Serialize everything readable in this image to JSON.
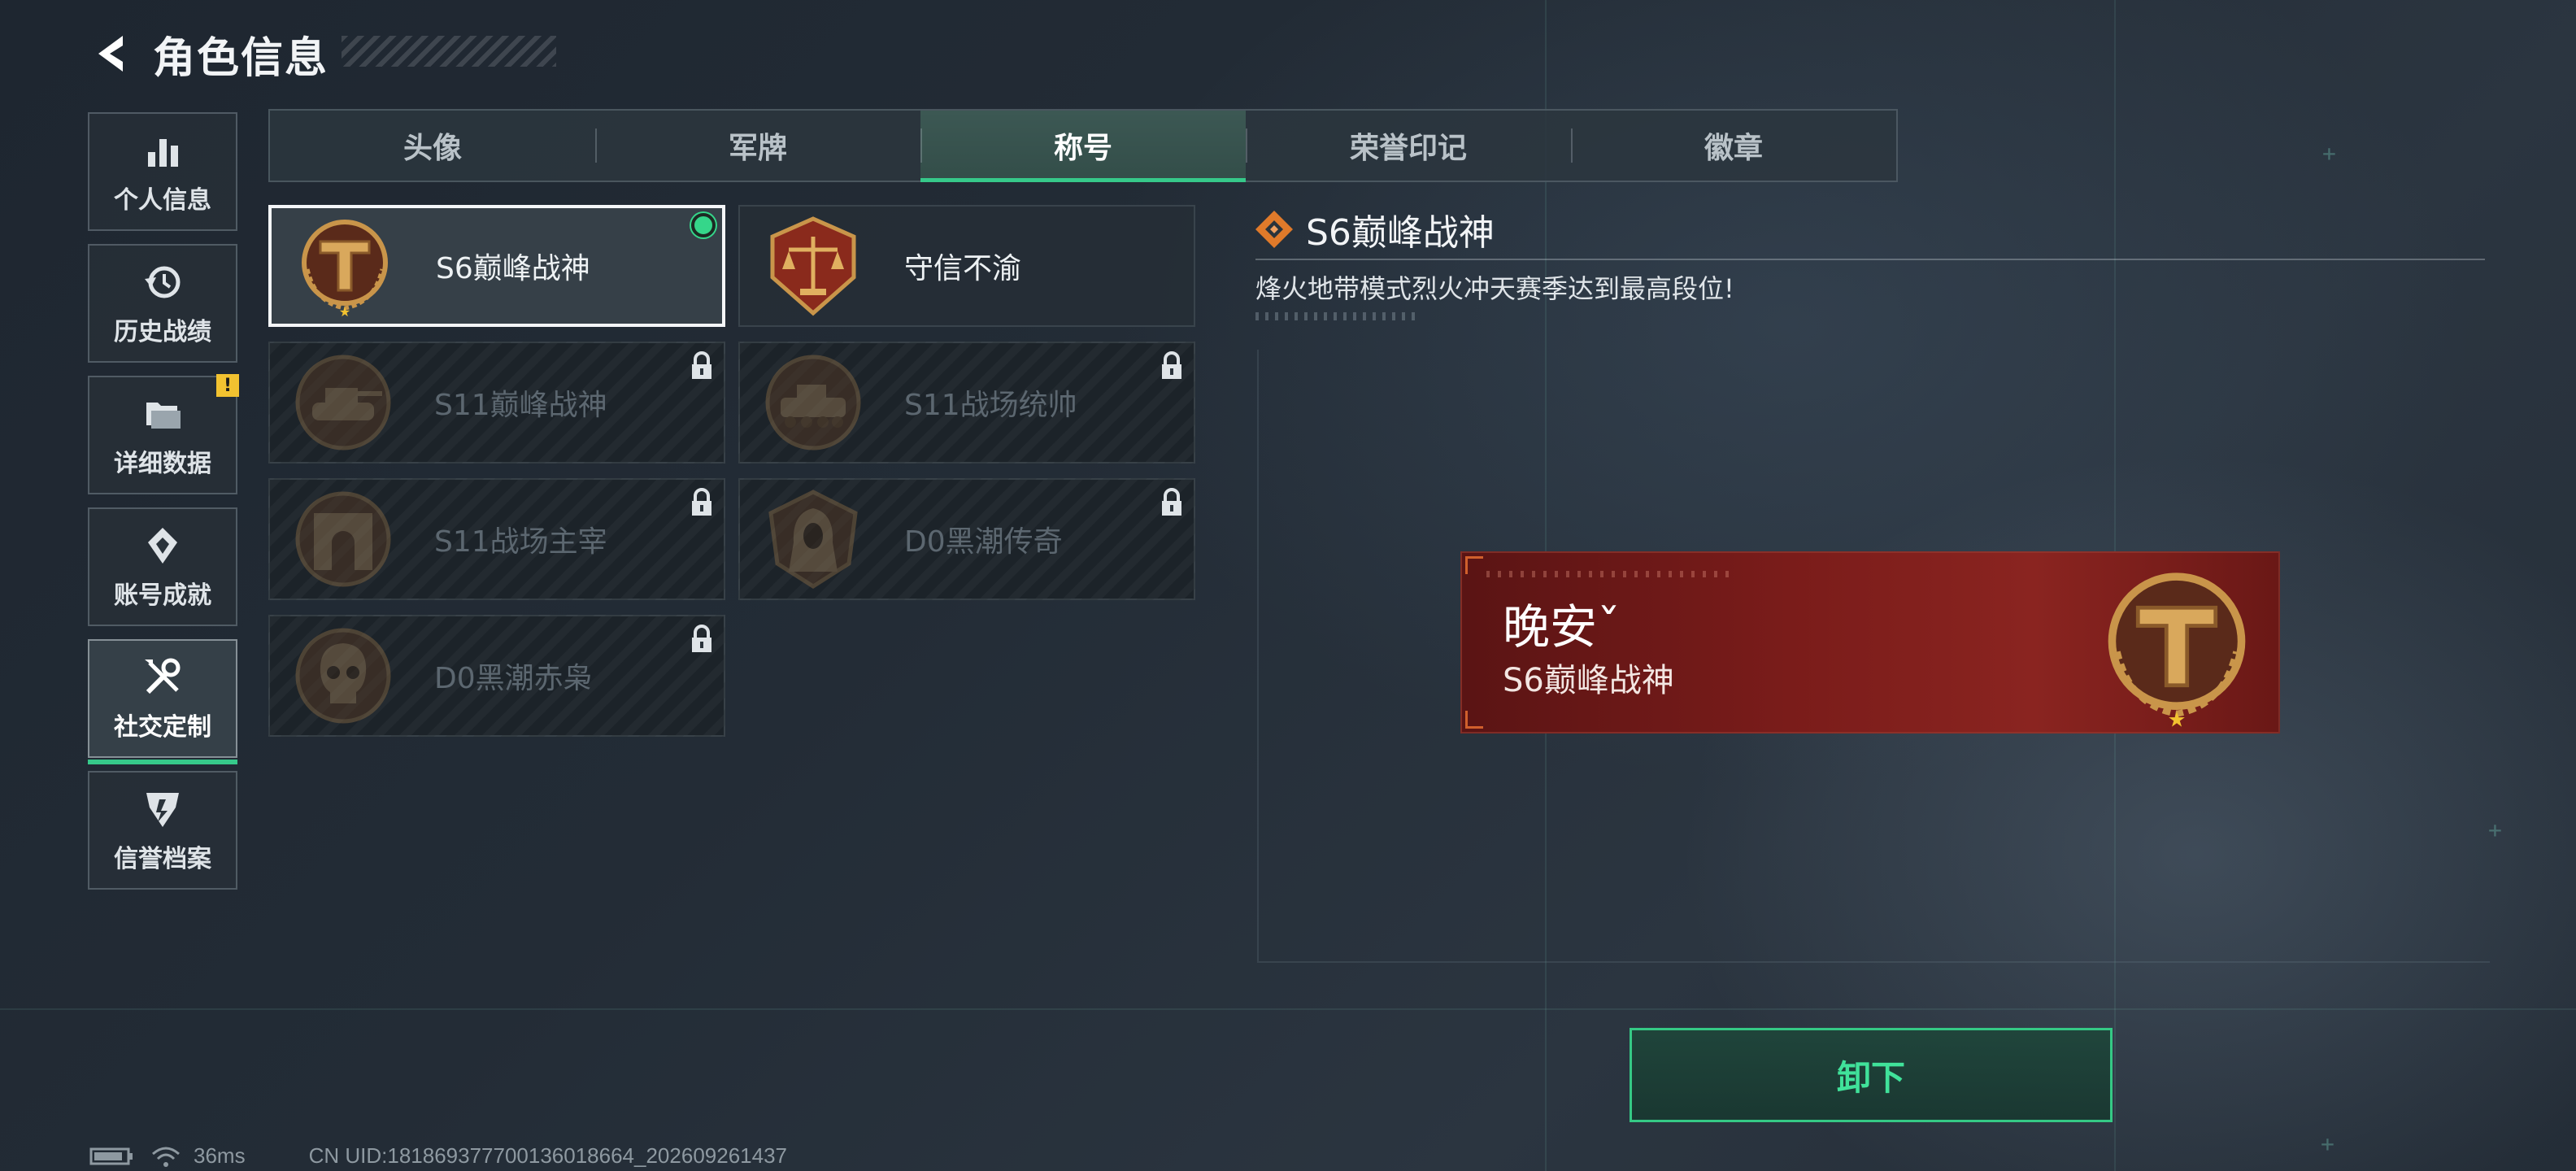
{
  "header": {
    "title": "角色信息"
  },
  "sidebar": {
    "items": [
      {
        "label": "个人信息",
        "icon": "bar-chart-icon"
      },
      {
        "label": "历史战绩",
        "icon": "history-clock-icon"
      },
      {
        "label": "详细数据",
        "icon": "folders-icon",
        "badge": "!"
      },
      {
        "label": "账号成就",
        "icon": "achievement-icon"
      },
      {
        "label": "社交定制",
        "icon": "tools-icon",
        "active": true
      },
      {
        "label": "信誉档案",
        "icon": "credit-shield-icon"
      }
    ]
  },
  "tabs": [
    {
      "label": "头像"
    },
    {
      "label": "军牌"
    },
    {
      "label": "称号",
      "active": true
    },
    {
      "label": "荣誉印记"
    },
    {
      "label": "徽章"
    }
  ],
  "titles": [
    {
      "name": "S6巅峰战神",
      "emblem": "t-shield-emblem",
      "state": "equipped"
    },
    {
      "name": "守信不渝",
      "emblem": "scales-emblem",
      "state": "unlocked"
    },
    {
      "name": "S11巅峰战神",
      "emblem": "tank-emblem",
      "state": "locked"
    },
    {
      "name": "S11战场统帅",
      "emblem": "armored-vehicle-emblem",
      "state": "locked"
    },
    {
      "name": "S11战场主宰",
      "emblem": "arch-emblem",
      "state": "locked"
    },
    {
      "name": "D0黑潮传奇",
      "emblem": "hooded-figure-emblem",
      "state": "locked"
    },
    {
      "name": "D0黑潮赤枭",
      "emblem": "skull-emblem",
      "state": "locked"
    }
  ],
  "detail": {
    "title": "S6巅峰战神",
    "description": "烽火地带模式烈火冲天赛季达到最高段位!"
  },
  "preview": {
    "player_name": "晚安ˇ",
    "title": "S6巅峰战神"
  },
  "unequip_label": "卸下",
  "status": {
    "ping": "36ms",
    "uid": "CN UID:181869377700136018664_202609261437"
  },
  "colors": {
    "accent": "#36c98a",
    "banner": "#7a1c1a",
    "gold": "#c9954a"
  }
}
